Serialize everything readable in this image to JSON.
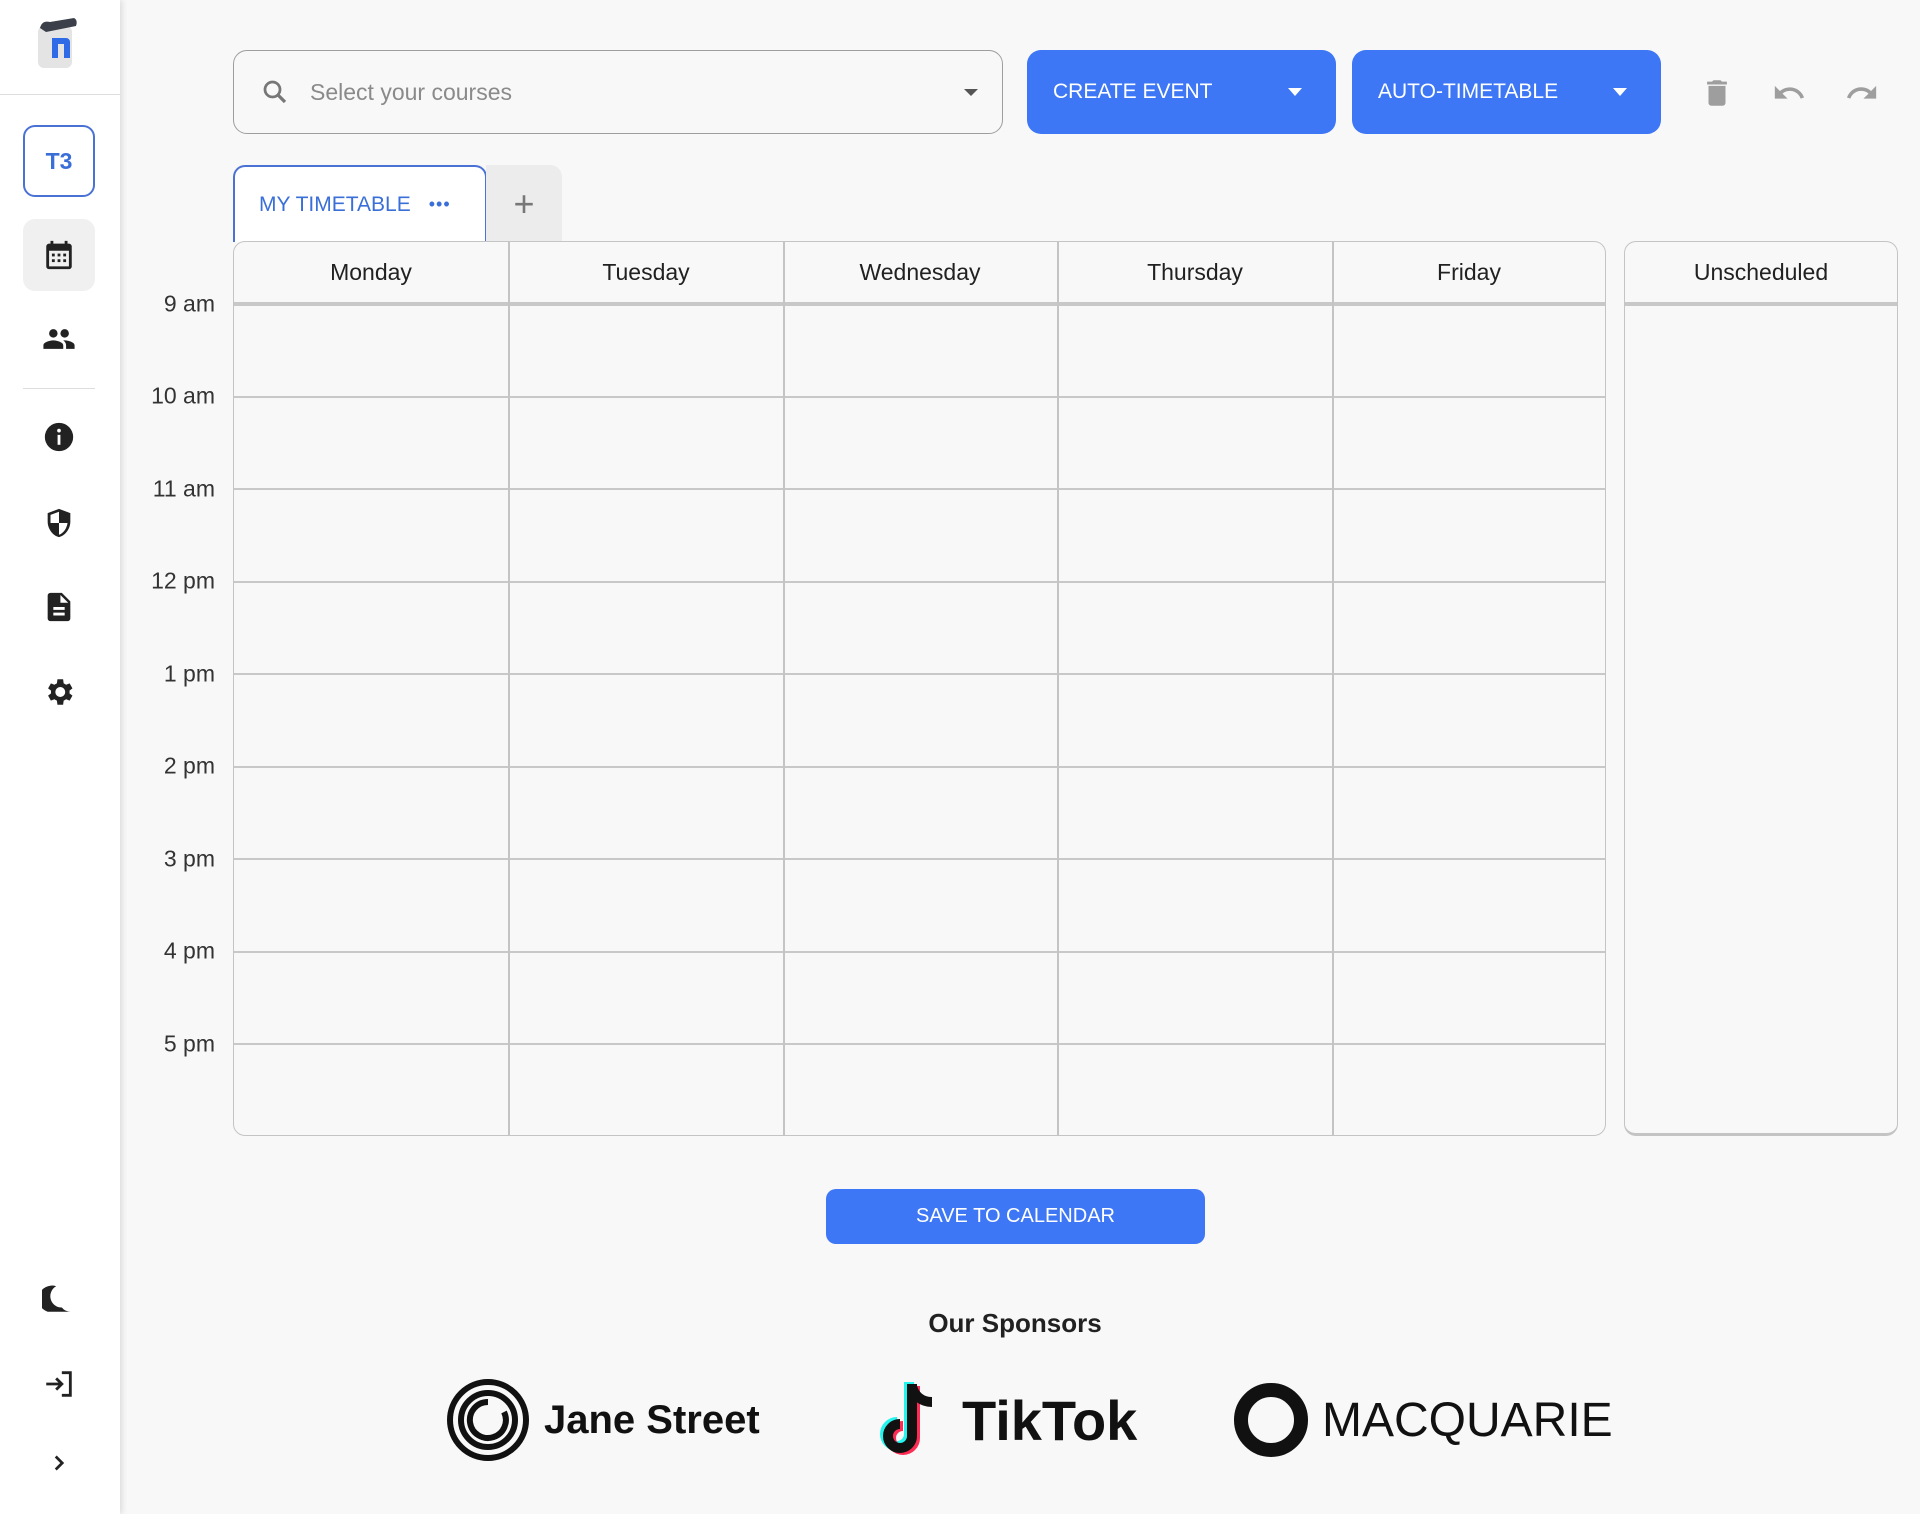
{
  "sidebar": {
    "profile_label": "T3",
    "items": [
      "calendar-icon",
      "people-icon",
      "info-icon",
      "shield-icon",
      "document-icon",
      "gear-icon"
    ],
    "bottom": [
      "moon-icon",
      "login-icon",
      "chevron-right-icon"
    ]
  },
  "toolbar": {
    "search_placeholder": "Select your courses",
    "create_event": "CREATE EVENT",
    "auto_timetable": "AUTO-TIMETABLE"
  },
  "tabs": [
    {
      "label": "MY TIMETABLE",
      "more": "•••"
    }
  ],
  "add_tab": "+",
  "days": [
    "Monday",
    "Tuesday",
    "Wednesday",
    "Thursday",
    "Friday"
  ],
  "unscheduled": "Unscheduled",
  "times": [
    "9 am",
    "10 am",
    "11 am",
    "12 pm",
    "1 pm",
    "2 pm",
    "3 pm",
    "4 pm",
    "5 pm"
  ],
  "save_button": "SAVE TO CALENDAR",
  "sponsors": {
    "title": "Our Sponsors",
    "names": [
      "Jane Street",
      "TikTok",
      "MACQUARIE"
    ]
  },
  "colors": {
    "accent": "#3d77f5",
    "tab_accent": "#3a6fd8"
  }
}
